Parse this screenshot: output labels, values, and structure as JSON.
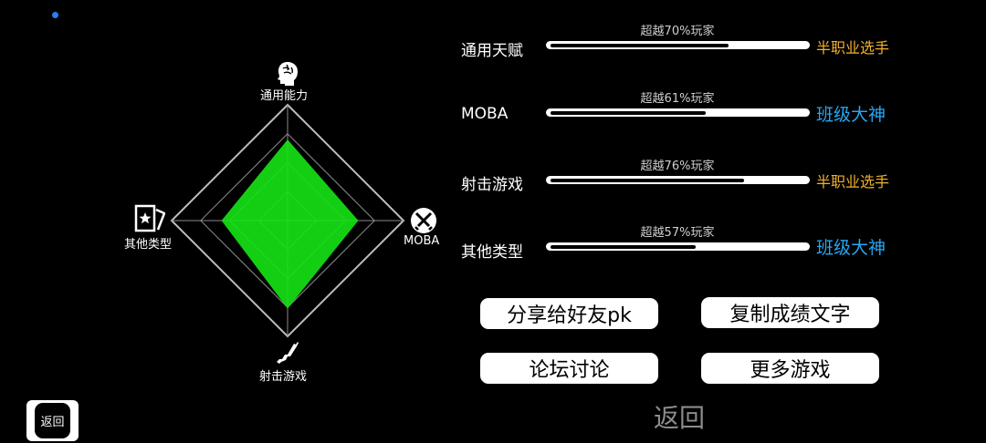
{
  "radar": {
    "axes": [
      {
        "label": "通用能力",
        "icon": "brain-head-icon",
        "value": 0.7
      },
      {
        "label": "MOBA",
        "icon": "crossed-swords-icon",
        "value": 0.61
      },
      {
        "label": "射击游戏",
        "icon": "rifle-icon",
        "value": 0.76
      },
      {
        "label": "其他类型",
        "icon": "card-deck-icon",
        "value": 0.57
      }
    ],
    "fill_color": "#16df16",
    "grid_color": "#8a8a8a",
    "levels": 4
  },
  "stats": [
    {
      "name": "通用天赋",
      "percent_text": "超越70%玩家",
      "percent": 0.7,
      "rank": "半职业选手",
      "rank_color": "#f2b129"
    },
    {
      "name": "MOBA",
      "percent_text": "超越61%玩家",
      "percent": 0.61,
      "rank": "班级大神",
      "rank_color": "#27a6f2"
    },
    {
      "name": "射击游戏",
      "percent_text": "超越76%玩家",
      "percent": 0.76,
      "rank": "半职业选手",
      "rank_color": "#f2b129"
    },
    {
      "name": "其他类型",
      "percent_text": "超越57%玩家",
      "percent": 0.57,
      "rank": "班级大神",
      "rank_color": "#27a6f2"
    }
  ],
  "buttons": {
    "share": "分享给好友pk",
    "copy": "复制成绩文字",
    "forum": "论坛讨论",
    "more_games": "更多游戏"
  },
  "back_text": "返回",
  "corner_back": "返回"
}
